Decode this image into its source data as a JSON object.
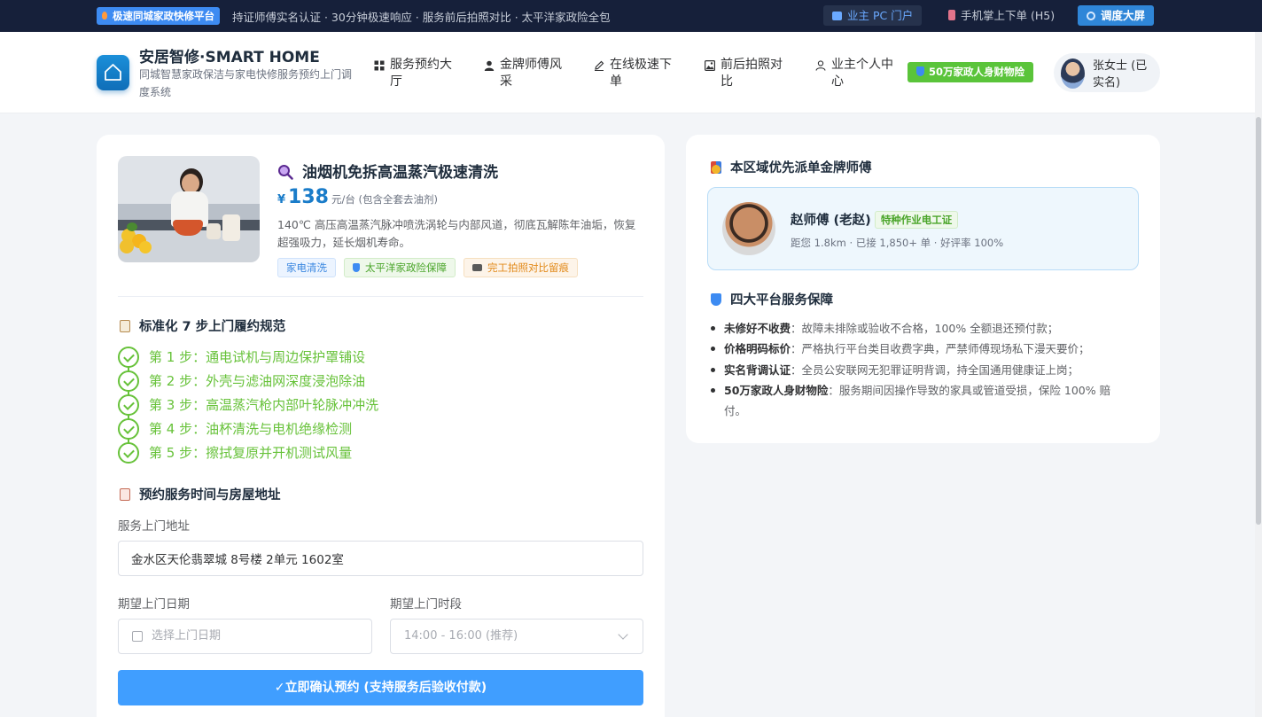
{
  "topbar": {
    "badge": "极速同城家政快修平台",
    "marquee": "持证师傅实名认证 · 30分钟极速响应 · 服务前后拍照对比 · 太平洋家政险全包",
    "pc_portal": "业主 PC 门户",
    "h5": "手机掌上下单 (H5)",
    "dashboard": "调度大屏"
  },
  "header": {
    "brand_title": "安居智修·SMART HOME",
    "brand_subtitle": "同城智慧家政保洁与家电快修服务预约上门调度系统",
    "nav": [
      {
        "label": "服务预约大厅",
        "icon": "grid-icon"
      },
      {
        "label": "金牌师傅风采",
        "icon": "user-icon"
      },
      {
        "label": "在线极速下单",
        "icon": "edit-icon"
      },
      {
        "label": "前后拍照对比",
        "icon": "image-icon"
      },
      {
        "label": "业主个人中心",
        "icon": "person-icon"
      }
    ],
    "insurance_badge": "50万家政人身财物险",
    "user_name": "张女士 (已实名)"
  },
  "product": {
    "title": "油烟机免拆高温蒸汽极速清洗",
    "currency": "¥",
    "price": "138",
    "price_unit": "元/台 (包含全套去油剂)",
    "description": "140℃ 高压高温蒸汽脉冲喷洗涡轮与内部风道，彻底瓦解陈年油垢，恢复超强吸力，延长烟机寿命。",
    "tags": [
      "家电清洗",
      "太平洋家政险保障",
      "完工拍照对比留痕"
    ]
  },
  "steps_section": {
    "title": "标准化 7 步上门履约规范",
    "steps": [
      "第 1 步：通电试机与周边保护罩铺设",
      "第 2 步：外壳与滤油网深度浸泡除油",
      "第 3 步：高温蒸汽枪内部叶轮脉冲冲洗",
      "第 4 步：油杯清洗与电机绝缘检测",
      "第 5 步：擦拭复原并开机测试风量"
    ]
  },
  "booking": {
    "title": "预约服务时间与房屋地址",
    "address_label": "服务上门地址",
    "address_value": "金水区天伦翡翠城 8号楼 2单元 1602室",
    "date_label": "期望上门日期",
    "date_placeholder": "选择上门日期",
    "slot_label": "期望上门时段",
    "slot_value": "14:00 - 16:00 (推荐)",
    "submit": "✓立即确认预约 (支持服务后验收付款)"
  },
  "master_section": {
    "title": "本区域优先派单金牌师傅",
    "name": "赵师傅 (老赵)",
    "cert": "特种作业电工证",
    "info": "距您 1.8km · 已接 1,850+ 单 · 好评率 100%"
  },
  "guarantee": {
    "title": "四大平台服务保障",
    "items": [
      {
        "head": "未修好不收费",
        "text": "：故障未排除或验收不合格，100% 全额退还预付款；"
      },
      {
        "head": "价格明码标价",
        "text": "：严格执行平台类目收费字典，严禁师傅现场私下漫天要价；"
      },
      {
        "head": "实名背调认证",
        "text": "：全员公安联网无犯罪证明背调，持全国通用健康证上岗；"
      },
      {
        "head": "50万家政人身财物险",
        "text": "：服务期间因操作导致的家具或管道受损，保险 100% 赔付。"
      }
    ]
  },
  "colors": {
    "primary": "#409eff",
    "success": "#67c23a",
    "brand_blue": "#1a7cc9",
    "topbar": "#16203a"
  }
}
